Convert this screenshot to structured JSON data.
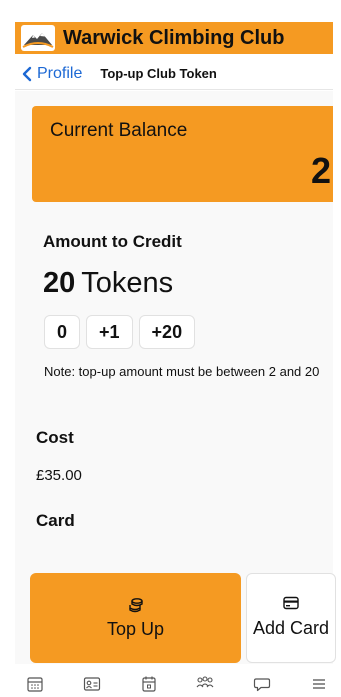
{
  "app": {
    "title": "Warwick Climbing Club",
    "brand_color": "#f59a22",
    "logo_icon": "mountain-icon"
  },
  "nav": {
    "back_label": "Profile",
    "title": "Top-up Club Token",
    "link_color": "#1c68d4"
  },
  "balance": {
    "label": "Current Balance",
    "value": "2"
  },
  "amount": {
    "label": "Amount to Credit",
    "count": "20",
    "unit": "Tokens",
    "buttons": [
      {
        "label": "0"
      },
      {
        "label": "+1"
      },
      {
        "label": "+20"
      }
    ],
    "note": "Note: top-up amount must be between 2 and 20"
  },
  "cost": {
    "label": "Cost",
    "value": "£35.00"
  },
  "card": {
    "label": "Card"
  },
  "actions": {
    "top_up_label": "Top Up",
    "top_up_icon": "coins-icon",
    "add_card_label": "Add Card",
    "add_card_icon": "credit-card-icon"
  },
  "tab_bar": {
    "icons": [
      "calendar-grid-icon",
      "id-card-icon",
      "calendar-icon",
      "people-icon",
      "chat-icon",
      "menu-icon"
    ]
  }
}
